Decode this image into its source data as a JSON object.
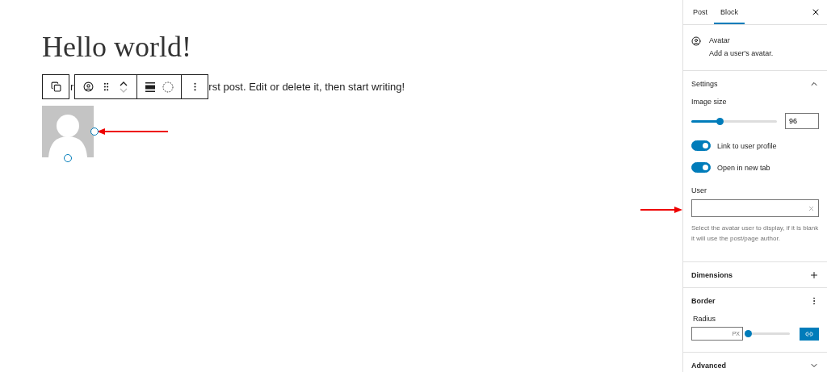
{
  "editor": {
    "title": "Hello world!",
    "hidden_fragment": "r",
    "paragraph": "rst post. Edit or delete it, then start writing!"
  },
  "sidebar": {
    "tabs": [
      {
        "label": "Post",
        "selected": false
      },
      {
        "label": "Block",
        "selected": true
      }
    ],
    "block": {
      "name": "Avatar",
      "description": "Add a user's avatar."
    },
    "settings": {
      "title": "Settings",
      "expanded": true,
      "image_size": {
        "label": "Image size",
        "level": 0.33,
        "value": "96"
      },
      "toggles": [
        {
          "label": "Link to user profile",
          "on": true
        },
        {
          "label": "Open in new tab",
          "on": true
        }
      ],
      "user": {
        "label": "User",
        "help": "Select the avatar user to display, if it is blank it will use the post/page author."
      }
    },
    "dimensions": {
      "title": "Dimensions"
    },
    "border": {
      "title": "Border",
      "radius": {
        "label": "Radius",
        "unit": "PX",
        "level": 0
      }
    },
    "advanced": {
      "title": "Advanced",
      "expanded": false
    }
  }
}
